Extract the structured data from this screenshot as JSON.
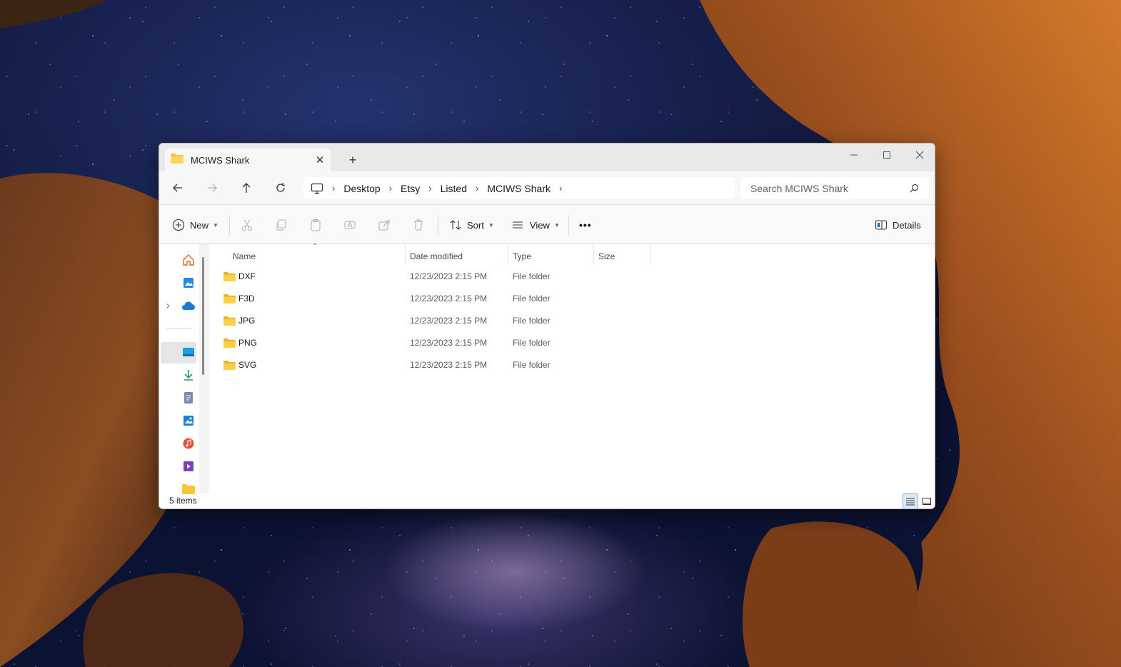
{
  "window": {
    "tab_title": "MCIWS Shark",
    "new_tab": "+",
    "tab_close": "✕"
  },
  "breadcrumb": {
    "items": [
      "Desktop",
      "Etsy",
      "Listed",
      "MCIWS Shark"
    ]
  },
  "search": {
    "placeholder": "Search MCIWS Shark"
  },
  "toolbar": {
    "new_label": "New",
    "sort_label": "Sort",
    "view_label": "View",
    "more_label": "•••",
    "details_label": "Details"
  },
  "columns": {
    "name": "Name",
    "date_modified": "Date modified",
    "type": "Type",
    "size": "Size"
  },
  "files": [
    {
      "name": "DXF",
      "date": "12/23/2023 2:15 PM",
      "type": "File folder",
      "size": ""
    },
    {
      "name": "F3D",
      "date": "12/23/2023 2:15 PM",
      "type": "File folder",
      "size": ""
    },
    {
      "name": "JPG",
      "date": "12/23/2023 2:15 PM",
      "type": "File folder",
      "size": ""
    },
    {
      "name": "PNG",
      "date": "12/23/2023 2:15 PM",
      "type": "File folder",
      "size": ""
    },
    {
      "name": "SVG",
      "date": "12/23/2023 2:15 PM",
      "type": "File folder",
      "size": ""
    }
  ],
  "status": {
    "item_count": "5 items"
  },
  "colors": {
    "accent": "#0067c0",
    "folder_yellow": "#f8c53a",
    "window_bg": "#ffffff",
    "titlebar_bg": "#e9e9e9"
  },
  "nav_icons": [
    "home-icon",
    "gallery-icon",
    "onedrive-icon",
    "desktop-icon",
    "downloads-icon",
    "documents-icon",
    "pictures-icon",
    "music-icon",
    "videos-icon",
    "folder-icon"
  ]
}
